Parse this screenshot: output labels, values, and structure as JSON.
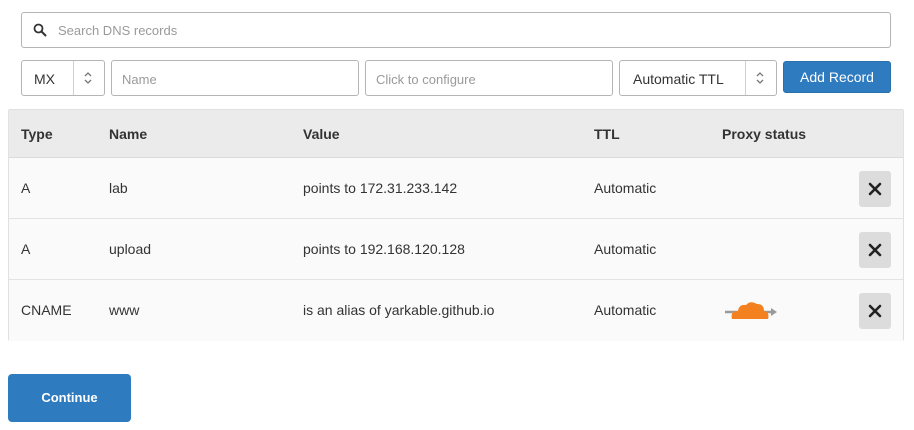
{
  "search": {
    "placeholder": "Search DNS records",
    "icon": "search-icon"
  },
  "form": {
    "type_value": "MX",
    "name_placeholder": "Name",
    "value_placeholder": "Click to configure",
    "ttl_value": "Automatic TTL",
    "add_label": "Add Record"
  },
  "table": {
    "headers": {
      "type": "Type",
      "name": "Name",
      "value": "Value",
      "ttl": "TTL",
      "proxy": "Proxy status"
    },
    "rows": [
      {
        "type": "A",
        "name": "lab",
        "value": "points to 172.31.233.142",
        "ttl": "Automatic",
        "proxied": false
      },
      {
        "type": "A",
        "name": "upload",
        "value": "points to 192.168.120.128",
        "ttl": "Automatic",
        "proxied": false
      },
      {
        "type": "CNAME",
        "name": "www",
        "value": "is an alias of yarkable.github.io",
        "ttl": "Automatic",
        "proxied": true
      }
    ]
  },
  "continue_label": "Continue",
  "colors": {
    "accent": "#2f7bbf",
    "proxy_orange": "#f48120",
    "delete_bg": "#dcdcdc"
  }
}
